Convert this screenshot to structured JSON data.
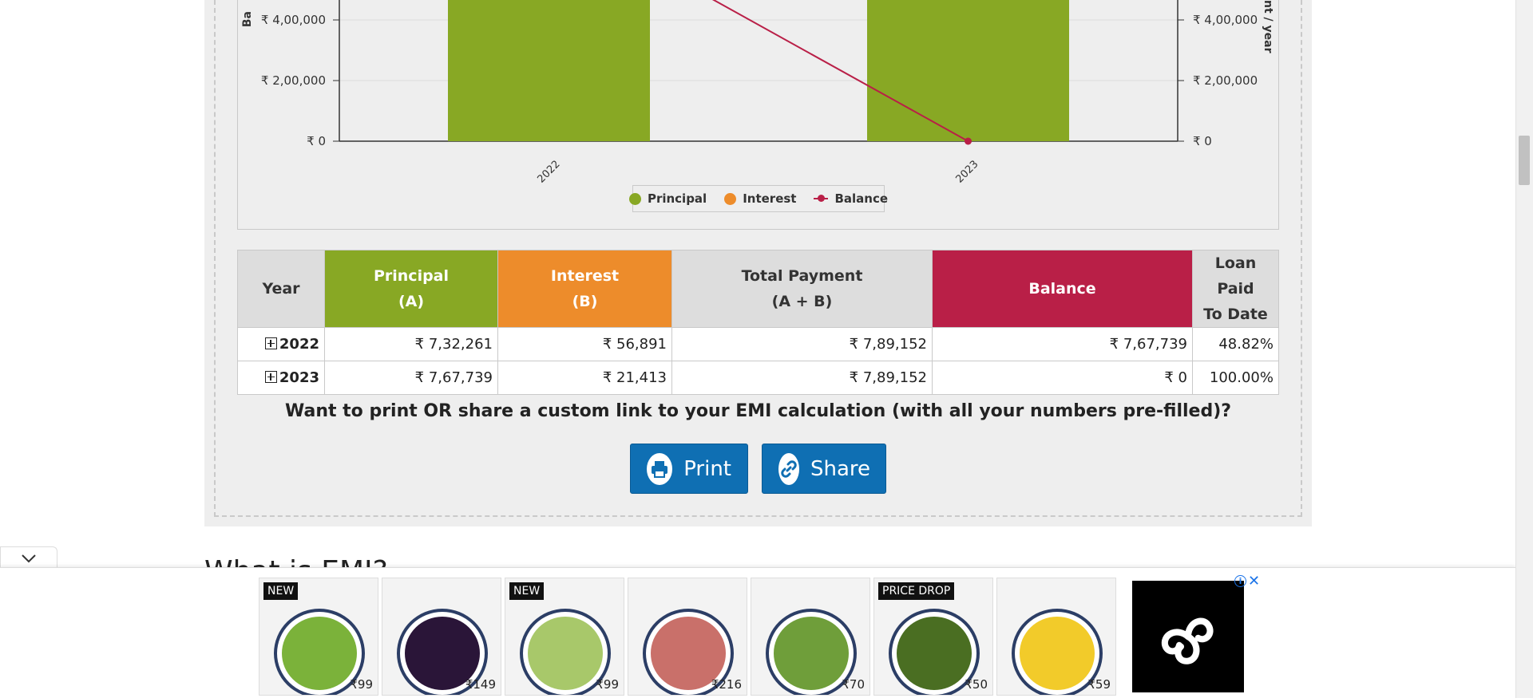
{
  "chart": {
    "left_axis_title": "Ba",
    "right_axis_title": "nt / year",
    "left_ticks": [
      "₹ 4,00,000",
      "₹ 2,00,000",
      "₹ 0"
    ],
    "right_ticks": [
      "₹ 4,00,000",
      "₹ 2,00,000",
      "₹ 0"
    ],
    "legend": {
      "principal": "Principal",
      "interest": "Interest",
      "balance": "Balance"
    }
  },
  "chart_data": {
    "type": "bar",
    "categories": [
      "2022",
      "2023"
    ],
    "series": [
      {
        "name": "Principal",
        "values": [
          732261,
          767739
        ]
      },
      {
        "name": "Interest",
        "values": [
          56891,
          21413
        ]
      },
      {
        "name": "Balance",
        "values": [
          767739,
          0
        ]
      }
    ],
    "ylim": [
      0,
      400000
    ],
    "grid": true,
    "legend_placement": "bottom-center",
    "colors": {
      "principal": "#88a824",
      "interest": "#ed8c2b",
      "balance": "#b91f47"
    }
  },
  "table": {
    "headers": {
      "year": "Year",
      "principal_1": "Principal",
      "principal_2": "(A)",
      "interest_1": "Interest",
      "interest_2": "(B)",
      "total_1": "Total Payment",
      "total_2": "(A + B)",
      "balance": "Balance",
      "paid_1": "Loan Paid",
      "paid_2": "To Date"
    },
    "rows": [
      {
        "year": "2022",
        "principal": "₹ 7,32,261",
        "interest": "₹ 56,891",
        "total": "₹ 7,89,152",
        "balance": "₹ 7,67,739",
        "paid": "48.82%"
      },
      {
        "year": "2023",
        "principal": "₹ 7,67,739",
        "interest": "₹ 21,413",
        "total": "₹ 7,89,152",
        "balance": "₹ 0",
        "paid": "100.00%"
      }
    ]
  },
  "cta": {
    "text": "Want to print OR share a custom link to your EMI calculation (with all your numbers pre-filled)?",
    "print_label": "Print",
    "share_label": "Share"
  },
  "next_heading": "What is EMI?",
  "ads": [
    {
      "tag": "NEW",
      "price": "₹99",
      "color": "#7bb23a"
    },
    {
      "tag": "",
      "price": "₹149",
      "color": "#2a1538"
    },
    {
      "tag": "NEW",
      "price": "₹99",
      "color": "#a8c86a"
    },
    {
      "tag": "",
      "price": "₹216",
      "color": "#c9706a"
    },
    {
      "tag": "",
      "price": "₹70",
      "color": "#6f9e3a"
    },
    {
      "tag": "PRICE DROP",
      "price": "₹50",
      "color": "#4a6e22"
    },
    {
      "tag": "",
      "price": "₹59",
      "color": "#f2cb2a"
    }
  ]
}
